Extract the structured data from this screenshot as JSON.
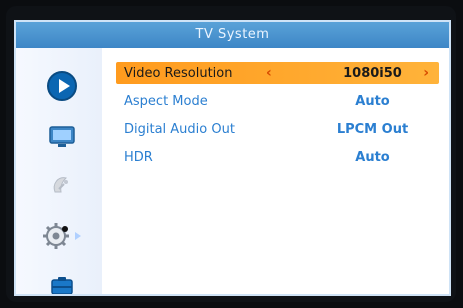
{
  "window": {
    "title": "TV System"
  },
  "menu": {
    "items": [
      {
        "label": "Video Resolution",
        "value": "1080i50",
        "selected": true
      },
      {
        "label": "Aspect Mode",
        "value": "Auto",
        "selected": false
      },
      {
        "label": "Digital Audio Out",
        "value": "LPCM Out",
        "selected": false
      },
      {
        "label": "HDR",
        "value": "Auto",
        "selected": false
      }
    ]
  },
  "sidebar": {
    "items": [
      {
        "icon": "play-icon"
      },
      {
        "icon": "display-icon"
      },
      {
        "icon": "satellite-dish-icon"
      },
      {
        "icon": "gear-icon"
      },
      {
        "icon": "toolbox-icon"
      }
    ]
  },
  "colors": {
    "accent": "#3d86c6",
    "highlight": "#ff9b1e",
    "text": "#2b7fd1"
  }
}
